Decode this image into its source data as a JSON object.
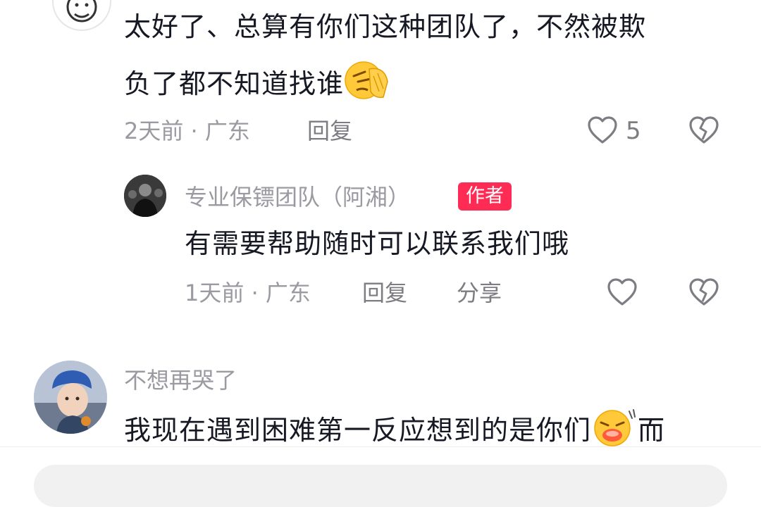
{
  "comments": [
    {
      "text_line1": "太好了、总算有你们这种团队了，不然被欺",
      "text_line2": "负了都不知道找谁",
      "emoji": "facepalm-emoji",
      "time": "2天前",
      "location": "广东",
      "reply_label": "回复",
      "likes": "5",
      "reply": {
        "user": "专业保镖团队（阿湘）",
        "badge": "作者",
        "text": "有需要帮助随时可以联系我们哦",
        "time": "1天前",
        "location": "广东",
        "reply_label": "回复",
        "share_label": "分享"
      }
    },
    {
      "user": "不想再哭了",
      "text": "我现在遇到困难第一反应想到的是你们",
      "emoji": "crying-face-emoji",
      "text_tail": "而"
    }
  ],
  "icons": {
    "like": "heart-outline-icon",
    "dislike": "broken-heart-icon"
  },
  "colors": {
    "primary_text": "#161823",
    "secondary_text": "#9a9aa1",
    "author_badge": "#fe2c55"
  }
}
